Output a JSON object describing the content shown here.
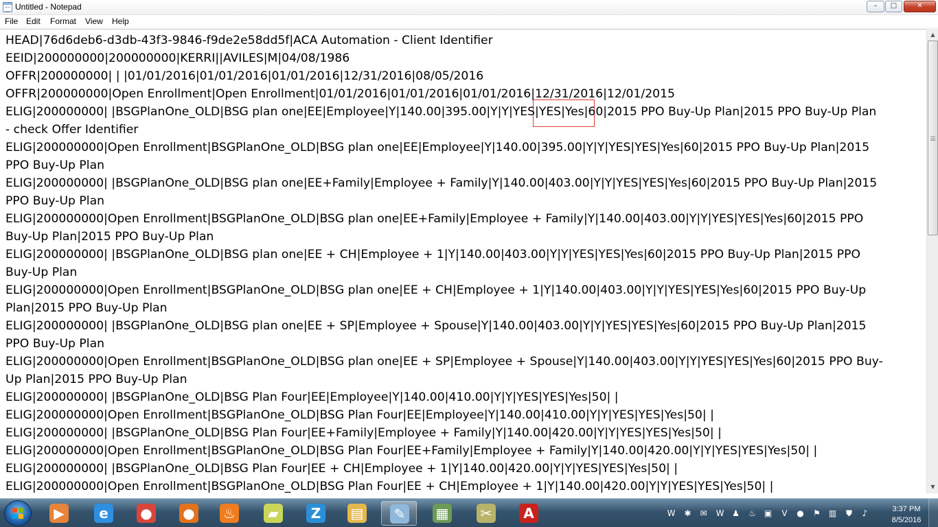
{
  "window": {
    "title": "Untitled - Notepad",
    "controls": {
      "minimize": "–",
      "maximize": "□",
      "close": "✕"
    }
  },
  "menu": [
    "File",
    "Edit",
    "Format",
    "View",
    "Help"
  ],
  "editor": {
    "lines": [
      "HEAD|76d6deb6-d3db-43f3-9846-f9de2e58dd5f|ACA Automation - Client Identifier",
      "EEID|200000000|200000000|KERRI||AVILES|M|04/08/1986",
      "OFFR|200000000| | |01/01/2016|01/01/2016|01/01/2016|12/31/2016|08/05/2016",
      "OFFR|200000000|Open Enrollment|Open Enrollment|01/01/2016|01/01/2016|01/01/2016|12/31/2016|12/01/2015",
      "ELIG|200000000| |BSGPlanOne_OLD|BSG plan one|EE|Employee|Y|140.00|395.00|Y|Y|YES|YES|Yes|60|2015 PPO Buy-Up Plan|2015 PPO Buy-Up Plan",
      "- check Offer Identifier",
      "ELIG|200000000|Open Enrollment|BSGPlanOne_OLD|BSG plan one|EE|Employee|Y|140.00|395.00|Y|Y|YES|YES|Yes|60|2015 PPO Buy-Up Plan|2015",
      "PPO Buy-Up Plan",
      "ELIG|200000000| |BSGPlanOne_OLD|BSG plan one|EE+Family|Employee + Family|Y|140.00|403.00|Y|Y|YES|YES|Yes|60|2015 PPO Buy-Up Plan|2015",
      "PPO Buy-Up Plan",
      "ELIG|200000000|Open Enrollment|BSGPlanOne_OLD|BSG plan one|EE+Family|Employee + Family|Y|140.00|403.00|Y|Y|YES|YES|Yes|60|2015 PPO",
      "Buy-Up Plan|2015 PPO Buy-Up Plan",
      "ELIG|200000000| |BSGPlanOne_OLD|BSG plan one|EE + CH|Employee + 1|Y|140.00|403.00|Y|Y|YES|YES|Yes|60|2015 PPO Buy-Up Plan|2015 PPO",
      "Buy-Up Plan",
      "ELIG|200000000|Open Enrollment|BSGPlanOne_OLD|BSG plan one|EE + CH|Employee + 1|Y|140.00|403.00|Y|Y|YES|YES|Yes|60|2015 PPO Buy-Up",
      "Plan|2015 PPO Buy-Up Plan",
      "ELIG|200000000| |BSGPlanOne_OLD|BSG plan one|EE + SP|Employee + Spouse|Y|140.00|403.00|Y|Y|YES|YES|Yes|60|2015 PPO Buy-Up Plan|2015",
      "PPO Buy-Up Plan",
      "ELIG|200000000|Open Enrollment|BSGPlanOne_OLD|BSG plan one|EE + SP|Employee + Spouse|Y|140.00|403.00|Y|Y|YES|YES|Yes|60|2015 PPO Buy-",
      "Up Plan|2015 PPO Buy-Up Plan",
      "ELIG|200000000| |BSGPlanOne_OLD|BSG Plan Four|EE|Employee|Y|140.00|410.00|Y|Y|YES|YES|Yes|50| |",
      "ELIG|200000000|Open Enrollment|BSGPlanOne_OLD|BSG Plan Four|EE|Employee|Y|140.00|410.00|Y|Y|YES|YES|Yes|50| |",
      "ELIG|200000000| |BSGPlanOne_OLD|BSG Plan Four|EE+Family|Employee + Family|Y|140.00|420.00|Y|Y|YES|YES|Yes|50| |",
      "ELIG|200000000|Open Enrollment|BSGPlanOne_OLD|BSG Plan Four|EE+Family|Employee + Family|Y|140.00|420.00|Y|Y|YES|YES|Yes|50| |",
      "ELIG|200000000| |BSGPlanOne_OLD|BSG Plan Four|EE + CH|Employee + 1|Y|140.00|420.00|Y|Y|YES|YES|Yes|50| |",
      "ELIG|200000000|Open Enrollment|BSGPlanOne_OLD|BSG Plan Four|EE + CH|Employee + 1|Y|140.00|420.00|Y|Y|YES|YES|Yes|50| |"
    ],
    "highlight_color": "#e0382f"
  },
  "scrollbar": {
    "up": "▲",
    "down": "▼"
  },
  "taskbar": {
    "pinned": [
      {
        "name": "media-center-icon",
        "glyph": "▶",
        "color": "#e8833a"
      },
      {
        "name": "internet-explorer-icon",
        "glyph": "e",
        "color": "#2f8fe0"
      },
      {
        "name": "chrome-icon",
        "glyph": "●",
        "color": "#d9453b"
      },
      {
        "name": "firefox-icon",
        "glyph": "●",
        "color": "#e3721c"
      },
      {
        "name": "flame-app-icon",
        "glyph": "♨",
        "color": "#f07c1e"
      },
      {
        "name": "sticky-notes-icon",
        "glyph": "▰",
        "color": "#c9d65a"
      },
      {
        "name": "z-app-icon",
        "glyph": "Z",
        "color": "#2b8fd8"
      },
      {
        "name": "file-explorer-icon",
        "glyph": "▤",
        "color": "#e5b84c"
      },
      {
        "name": "notepad-icon",
        "glyph": "✎",
        "color": "#8fb8db"
      },
      {
        "name": "spreadsheet-app-icon",
        "glyph": "▦",
        "color": "#6e9a57"
      },
      {
        "name": "tools-app-icon",
        "glyph": "✂",
        "color": "#b9b36a"
      },
      {
        "name": "acrobat-icon",
        "glyph": "A",
        "color": "#c9221c"
      }
    ],
    "tray": [
      {
        "name": "shield-tray-icon",
        "glyph": "W"
      },
      {
        "name": "network-share-tray-icon",
        "glyph": "✱"
      },
      {
        "name": "mail-tray-icon",
        "glyph": "✉"
      },
      {
        "name": "wifi-tray-icon",
        "glyph": "W"
      },
      {
        "name": "users-tray-icon",
        "glyph": "♟"
      },
      {
        "name": "java-tray-icon",
        "glyph": "♨"
      },
      {
        "name": "monitor-tray-icon",
        "glyph": "▣"
      },
      {
        "name": "antivirus-tray-icon",
        "glyph": "V"
      },
      {
        "name": "firefox-tray-icon",
        "glyph": "●"
      },
      {
        "name": "flag-tray-icon",
        "glyph": "⚑"
      },
      {
        "name": "network-tray-icon",
        "glyph": "▥"
      },
      {
        "name": "security-tray-icon",
        "glyph": "⛊"
      },
      {
        "name": "volume-tray-icon",
        "glyph": "♪"
      }
    ],
    "clock_time": "3:37 PM",
    "clock_date": "8/5/2016"
  }
}
